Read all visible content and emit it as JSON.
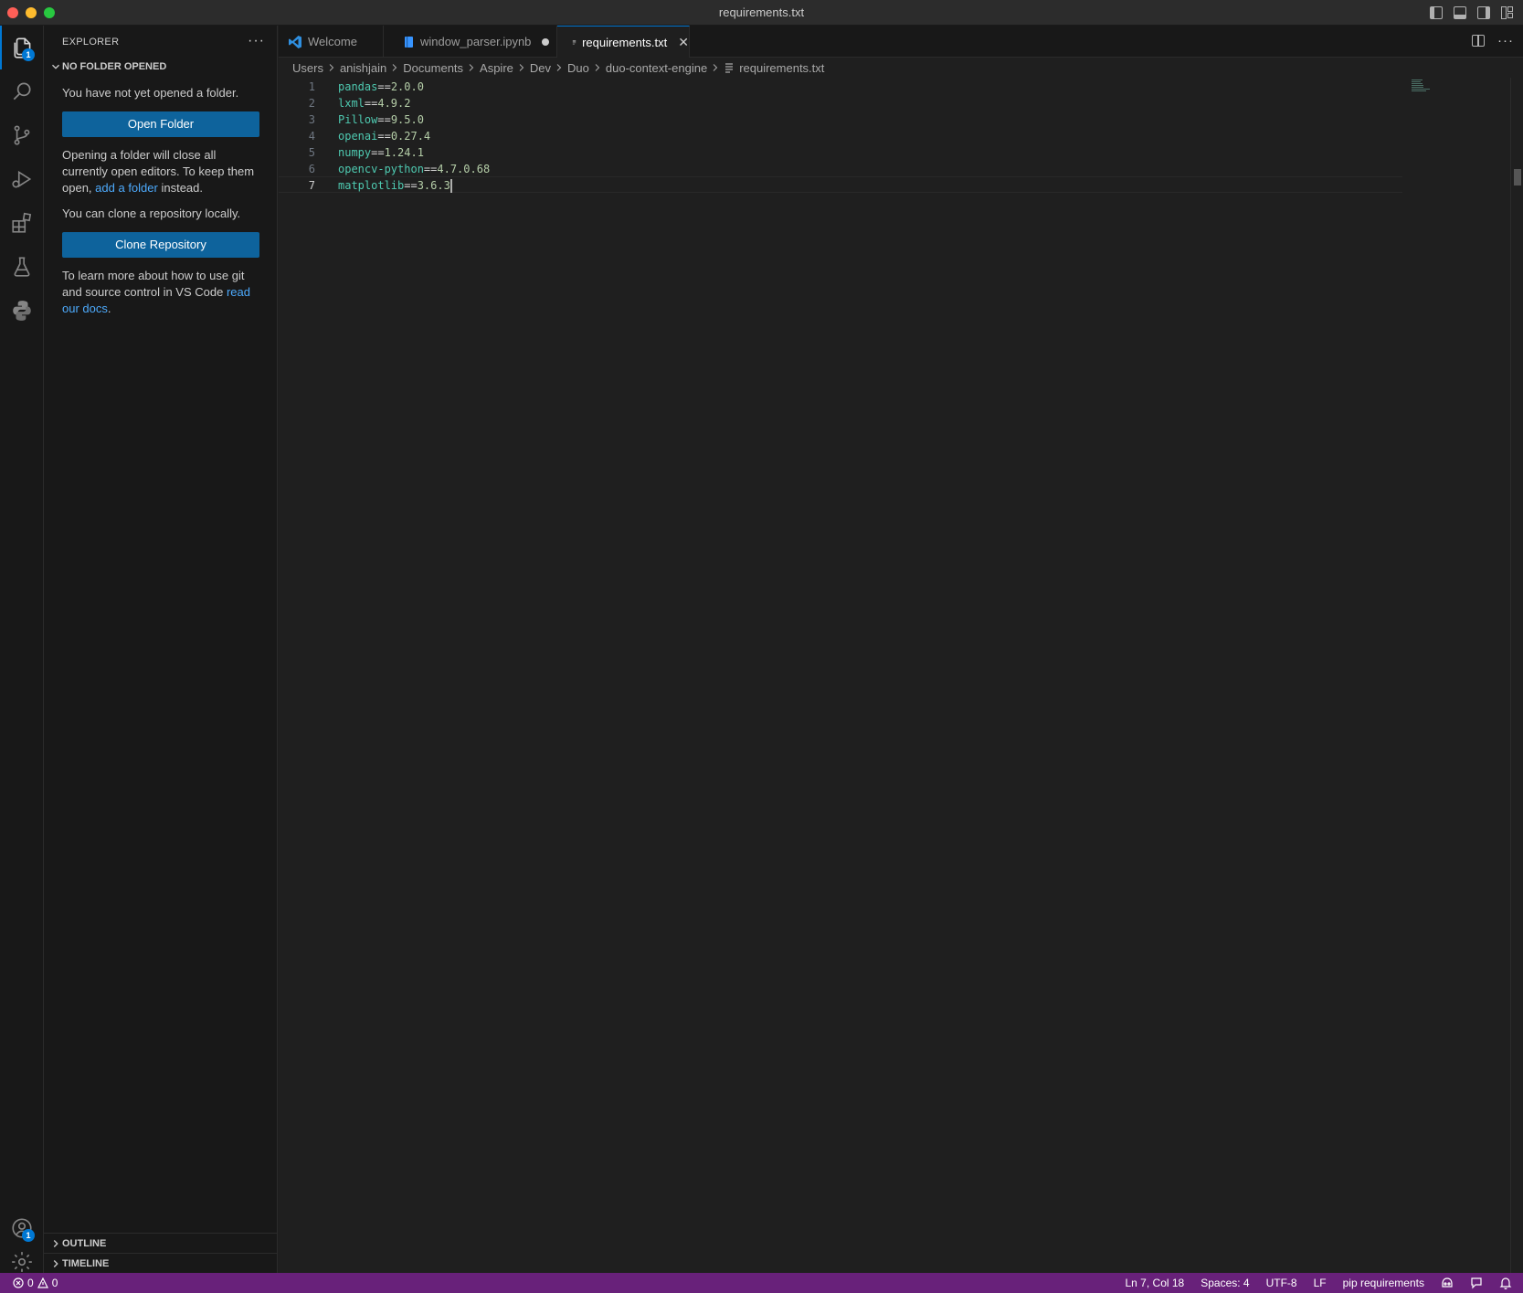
{
  "window": {
    "title": "requirements.txt"
  },
  "activity_bar": {
    "explorer_badge": "1",
    "accounts_badge": "1"
  },
  "sidebar": {
    "title": "EXPLORER",
    "more": "···",
    "section_title": "NO FOLDER OPENED",
    "no_folder_text": "You have not yet opened a folder.",
    "open_folder_button": "Open Folder",
    "opening_text_1": "Opening a folder will close all currently open editors. To keep them open,",
    "add_folder_link": "add a folder",
    "opening_text_2": "instead.",
    "clone_text": "You can clone a repository locally.",
    "clone_button": "Clone Repository",
    "learn_text": "To learn more about how to use git and source control in VS Code",
    "read_docs_link": "read our docs",
    "learn_end": ".",
    "outline_title": "OUTLINE",
    "timeline_title": "TIMELINE"
  },
  "tabs": [
    {
      "label": "Welcome",
      "icon": "vscode-logo-icon"
    },
    {
      "label": "window_parser.ipynb",
      "icon": "notebook-icon",
      "dirty": true
    },
    {
      "label": "requirements.txt",
      "icon": "text-file-icon",
      "active": true
    }
  ],
  "breadcrumbs": [
    "Users",
    "anishjain",
    "Documents",
    "Aspire",
    "Dev",
    "Duo",
    "duo-context-engine",
    "requirements.txt"
  ],
  "editor": {
    "lines": [
      {
        "num": "1",
        "pkg": "pandas",
        "op": "==",
        "ver": "2.0.0"
      },
      {
        "num": "2",
        "pkg": "lxml",
        "op": "==",
        "ver": "4.9.2"
      },
      {
        "num": "3",
        "pkg": "Pillow",
        "op": "==",
        "ver": "9.5.0"
      },
      {
        "num": "4",
        "pkg": "openai",
        "op": "==",
        "ver": "0.27.4"
      },
      {
        "num": "5",
        "pkg": "numpy",
        "op": "==",
        "ver": "1.24.1"
      },
      {
        "num": "6",
        "pkg": "opencv-python",
        "op": "==",
        "ver": "4.7.0.68"
      },
      {
        "num": "7",
        "pkg": "matplotlib",
        "op": "==",
        "ver": "3.6.3"
      }
    ],
    "current_line": 7
  },
  "statusbar": {
    "errors": "0",
    "warnings": "0",
    "position": "Ln 7, Col 18",
    "spaces": "Spaces: 4",
    "encoding": "UTF-8",
    "eol": "LF",
    "language": "pip requirements"
  },
  "colors": {
    "accent": "#0078d4",
    "statusbar": "#68217a",
    "button": "#0e639c",
    "link": "#4daafc"
  }
}
